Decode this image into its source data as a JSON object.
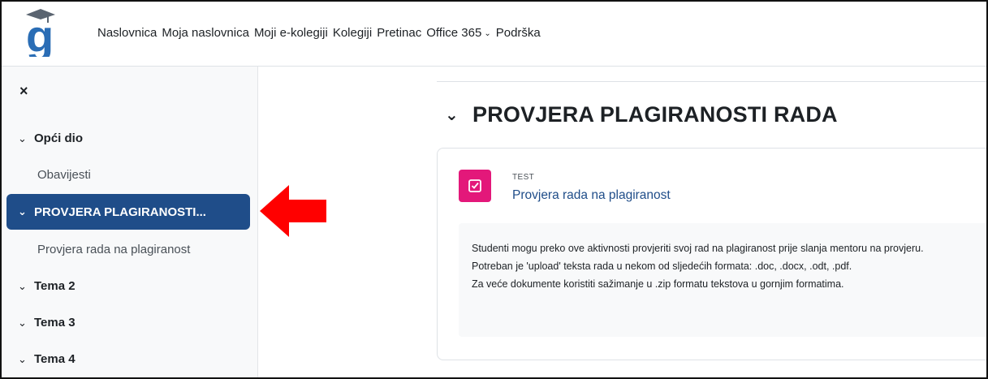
{
  "navbar": {
    "logo_alt": "g",
    "items": [
      {
        "label": "Naslovnica"
      },
      {
        "label": "Moja naslovnica"
      },
      {
        "label": "Moji e-kolegiji"
      },
      {
        "label": "Kolegiji"
      },
      {
        "label": "Pretinac"
      },
      {
        "label": "Office 365",
        "dropdown": true
      },
      {
        "label": "Podrška"
      }
    ]
  },
  "drawer": {
    "close_icon": "×",
    "sections": [
      {
        "label": "Opći dio",
        "expanded": true,
        "items": [
          {
            "label": "Obavijesti"
          }
        ]
      },
      {
        "label": "PROVJERA PLAGIRANOSTI...",
        "expanded": true,
        "active": true,
        "items": [
          {
            "label": "Provjera rada na plagiranost"
          }
        ]
      },
      {
        "label": "Tema 2",
        "expanded": true
      },
      {
        "label": "Tema 3",
        "expanded": true
      },
      {
        "label": "Tema 4",
        "expanded": true
      }
    ]
  },
  "main": {
    "section_title": "PROVJERA PLAGIRANOSTI RADA",
    "activity": {
      "type": "TEST",
      "name": "Provjera rada na plagiranost",
      "icon": "quiz-checkbox-icon",
      "icon_color": "#e3187a",
      "description": [
        "Studenti mogu preko ove aktivnosti provjeriti svoj rad na plagiranost prije slanja mentoru na provjeru.",
        "Potreban je 'upload' teksta rada u nekom od sljedećih formata: .doc, .docx, .odt, .pdf.",
        "Za veće dokumente koristiti sažimanje u .zip formatu tekstova u gornjim formatima."
      ]
    }
  },
  "colors": {
    "active_nav": "#1f4d89",
    "link": "#1f4d89",
    "arrow": "#ff0000",
    "drawer_bg": "#f8f9fa"
  }
}
